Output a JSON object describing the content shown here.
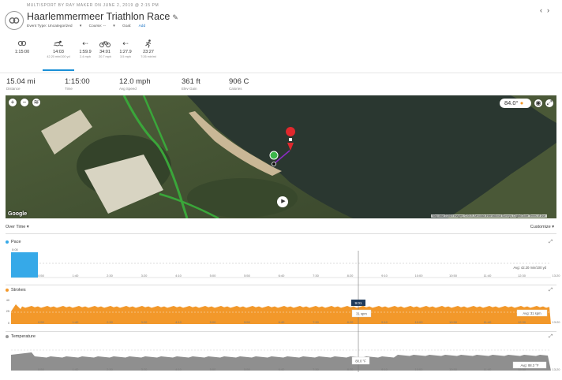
{
  "header": {
    "topline": "Multisport by Ray Maker on June 2, 2019 @ 2:15 PM",
    "title": "Haarlemmermeer Triathlon Race",
    "meta": {
      "event_type": "Event Type: Uncategorized",
      "course": "Course: --",
      "goal_label": "Goal:",
      "goal_link": "Add"
    },
    "nav_prev": "‹",
    "nav_next": "›"
  },
  "legs": [
    {
      "icon": "chain-icon",
      "time": "1:15:00",
      "sub": ""
    },
    {
      "icon": "swim-icon",
      "time": "14:03",
      "sub": "42.20 min/100 yd",
      "active": true
    },
    {
      "icon": "transition-icon",
      "time": "1:59.9",
      "sub": "2.4 mph"
    },
    {
      "icon": "bike-icon",
      "time": "34:01",
      "sub": "20.7 mph"
    },
    {
      "icon": "transition-icon",
      "time": "1:27.9",
      "sub": "3.5 mph"
    },
    {
      "icon": "run-icon",
      "time": "23:27",
      "sub": "7:26 min/mi"
    }
  ],
  "stats": [
    {
      "value": "15.04 mi",
      "label": "Distance"
    },
    {
      "value": "1:15:00",
      "label": "Time"
    },
    {
      "value": "12.0 mph",
      "label": "Avg Speed"
    },
    {
      "value": "361 ft",
      "label": "Elev Gain"
    },
    {
      "value": "906 C",
      "label": "Calories"
    }
  ],
  "map": {
    "temperature": "84.0°",
    "google": "Google",
    "attribution": "Map data ©2019 Imagery ©2019, Aerodata International Surveys, DigitalGlobe   Terms of Use",
    "colors": {
      "water": "#24312a",
      "track": "#3aa63a",
      "path": "#8a2bc2",
      "pin": "#e0282d"
    }
  },
  "overtime": {
    "label": "Over Time ▾",
    "customize": "Customize ▾"
  },
  "sections": {
    "pace": {
      "label": "Pace",
      "color": "#36a9e8",
      "ticks_y": [
        "0:00"
      ],
      "avg": "Avg: 42.20 min/100 yd"
    },
    "strokes": {
      "label": "Strokes",
      "color": "#f2982a",
      "ticks_y": [
        "40",
        "25",
        "0"
      ],
      "avg": "Avg: 31 spm",
      "cursor_time": "9:01",
      "cursor_value": "31 spm"
    },
    "temperature": {
      "label": "Temperature",
      "color": "#999999",
      "avg": "Avg: 88.3 °F",
      "cursor_value": "88.0 °F"
    }
  },
  "time_ticks": [
    "0:50",
    "1:40",
    "2:30",
    "3:20",
    "4:10",
    "5:00",
    "5:50",
    "6:40",
    "7:30",
    "8:20",
    "9:10",
    "10:00",
    "10:50",
    "11:40",
    "12:30",
    "13:20"
  ]
}
